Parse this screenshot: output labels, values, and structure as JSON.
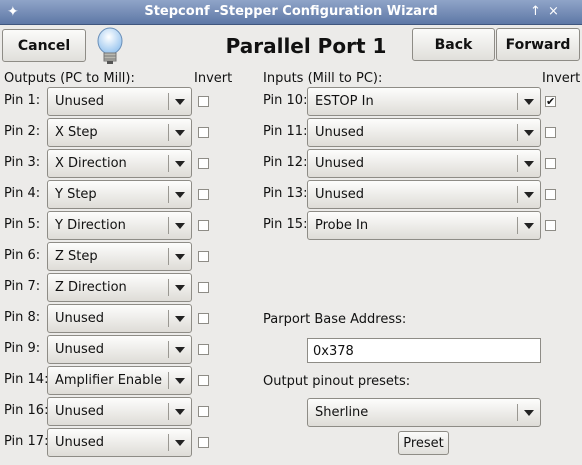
{
  "window": {
    "title": "Stepconf -Stepper Configuration Wizard",
    "buttons": [
      "↑",
      "×"
    ]
  },
  "toolbar": {
    "cancel_label": "Cancel",
    "back_label": "Back",
    "forward_label": "Forward",
    "page_title": "Parallel Port 1"
  },
  "outputs": {
    "header": "Outputs (PC to Mill):",
    "invert_header": "Invert",
    "pins": [
      {
        "label": "Pin 1:",
        "value": "Unused",
        "inverted": false
      },
      {
        "label": "Pin 2:",
        "value": "X Step",
        "inverted": false
      },
      {
        "label": "Pin 3:",
        "value": "X Direction",
        "inverted": false
      },
      {
        "label": "Pin 4:",
        "value": "Y Step",
        "inverted": false
      },
      {
        "label": "Pin 5:",
        "value": "Y Direction",
        "inverted": false
      },
      {
        "label": "Pin 6:",
        "value": "Z Step",
        "inverted": false
      },
      {
        "label": "Pin 7:",
        "value": "Z Direction",
        "inverted": false
      },
      {
        "label": "Pin 8:",
        "value": "Unused",
        "inverted": false
      },
      {
        "label": "Pin 9:",
        "value": "Unused",
        "inverted": false
      },
      {
        "label": "Pin 14:",
        "value": "Amplifier Enable",
        "inverted": false
      },
      {
        "label": "Pin 16:",
        "value": "Unused",
        "inverted": false
      },
      {
        "label": "Pin 17:",
        "value": "Unused",
        "inverted": false
      }
    ]
  },
  "inputs": {
    "header": "Inputs (Mill to PC):",
    "invert_header": "Invert",
    "pins": [
      {
        "label": "Pin 10:",
        "value": "ESTOP In",
        "inverted": true
      },
      {
        "label": "Pin 11:",
        "value": "Unused",
        "inverted": false
      },
      {
        "label": "Pin 12:",
        "value": "Unused",
        "inverted": false
      },
      {
        "label": "Pin 13:",
        "value": "Unused",
        "inverted": false
      },
      {
        "label": "Pin 15:",
        "value": "Probe In",
        "inverted": false
      }
    ]
  },
  "parport": {
    "base_label": "Parport Base Address:",
    "base_value": "0x378",
    "presets_label": "Output pinout presets:",
    "preset_value": "Sherline",
    "preset_button": "Preset"
  },
  "check_mark": "✔"
}
